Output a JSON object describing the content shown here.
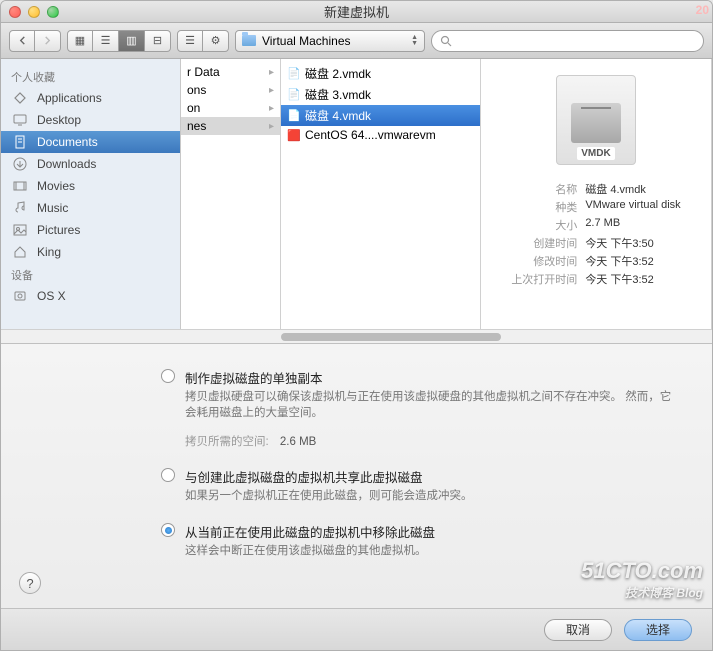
{
  "window": {
    "title": "新建虚拟机"
  },
  "toolbar": {
    "path_label": "Virtual Machines",
    "search_placeholder": ""
  },
  "sidebar": {
    "section_favorites": "个人收藏",
    "section_devices": "设备",
    "items": [
      {
        "label": "Applications",
        "icon": "app"
      },
      {
        "label": "Desktop",
        "icon": "desktop"
      },
      {
        "label": "Documents",
        "icon": "doc",
        "selected": true
      },
      {
        "label": "Downloads",
        "icon": "down"
      },
      {
        "label": "Movies",
        "icon": "movie"
      },
      {
        "label": "Music",
        "icon": "music"
      },
      {
        "label": "Pictures",
        "icon": "pic"
      },
      {
        "label": "King",
        "icon": "home"
      }
    ],
    "devices": [
      {
        "label": "OS X",
        "icon": "disk"
      }
    ]
  },
  "col1": {
    "items": [
      {
        "label": "r Data"
      },
      {
        "label": "ons"
      },
      {
        "label": "on"
      },
      {
        "label": "nes",
        "selected": true
      }
    ]
  },
  "col2": {
    "items": [
      {
        "label": "磁盘 2.vmdk",
        "type": "file"
      },
      {
        "label": "磁盘 3.vmdk",
        "type": "file"
      },
      {
        "label": "磁盘 4.vmdk",
        "type": "file",
        "selected": true
      },
      {
        "label": "CentOS 64....vmwarevm",
        "type": "vm"
      }
    ]
  },
  "preview": {
    "badge": "VMDK",
    "rows": [
      {
        "label": "名称",
        "value": "磁盘 4.vmdk"
      },
      {
        "label": "种类",
        "value": "VMware virtual disk"
      },
      {
        "label": "大小",
        "value": "2.7 MB"
      },
      {
        "label": "创建时间",
        "value": "今天 下午3:50"
      },
      {
        "label": "修改时间",
        "value": "今天 下午3:52"
      },
      {
        "label": "上次打开时间",
        "value": "今天 下午3:52"
      }
    ]
  },
  "options": {
    "opt1": {
      "title": "制作虚拟磁盘的单独副本",
      "desc": "拷贝虚拟硬盘可以确保该虚拟机与正在使用该虚拟硬盘的其他虚拟机之间不存在冲突。\n然而，它会耗用磁盘上的大量空间。"
    },
    "space": {
      "label": "拷贝所需的空间:",
      "value": "2.6 MB"
    },
    "opt2": {
      "title": "与创建此虚拟磁盘的虚拟机共享此虚拟磁盘",
      "desc": "如果另一个虚拟机正在使用此磁盘，则可能会造成冲突。"
    },
    "opt3": {
      "title": "从当前正在使用此磁盘的虚拟机中移除此磁盘",
      "desc": "这样会中断正在使用该虚拟磁盘的其他虚拟机。",
      "checked": true
    }
  },
  "footer": {
    "cancel": "取消",
    "choose": "选择"
  },
  "watermark": {
    "main": "51CTO.com",
    "sub": "技术博客  Blog"
  },
  "corner_ts": "20"
}
